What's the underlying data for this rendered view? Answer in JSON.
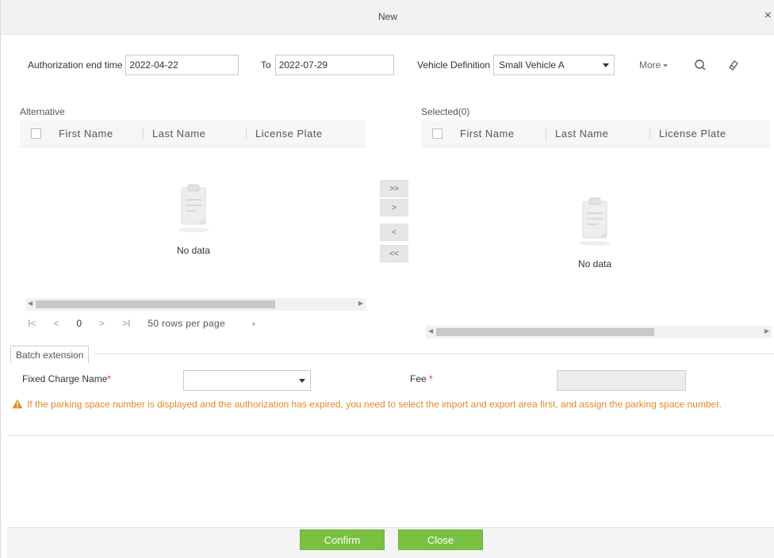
{
  "dialog": {
    "title": "New",
    "close_label": "×"
  },
  "filters": {
    "auth_end_label": "Authorization end time",
    "auth_start_value": "2022-04-22",
    "to_label": "To",
    "auth_end_value": "2022-07-29",
    "vehicle_def_label": "Vehicle Definition",
    "vehicle_def_value": "Small Vehicle A",
    "more_label": "More"
  },
  "alternative": {
    "title": "Alternative",
    "columns": [
      "First Name",
      "Last Name",
      "License Plate"
    ],
    "empty_text": "No data",
    "pager": {
      "first": "I<",
      "prev": "<",
      "page": "0",
      "next": ">",
      "last": ">I",
      "rows_per_page": "50 rows per page"
    }
  },
  "selected": {
    "title": "Selected(0)",
    "columns": [
      "First Name",
      "Last Name",
      "License Plate"
    ],
    "empty_text": "No data"
  },
  "transfer_buttons": [
    ">>",
    ">",
    "<",
    "<<"
  ],
  "batch": {
    "tab_label": "Batch extension",
    "fixed_charge_label": "Fixed Charge Name",
    "fixed_charge_value": "",
    "fee_label": "Fee",
    "fee_value": "",
    "required_mark": "*",
    "warning": "If the parking space number is displayed and the authorization has expired, you need to select the import and export area first, and assign the parking space number."
  },
  "footer": {
    "confirm_label": "Confirm",
    "close_label": "Close"
  },
  "colors": {
    "primary_green": "#7ac143",
    "warning_orange": "#e08a2a",
    "required_red": "#e23b3b"
  }
}
